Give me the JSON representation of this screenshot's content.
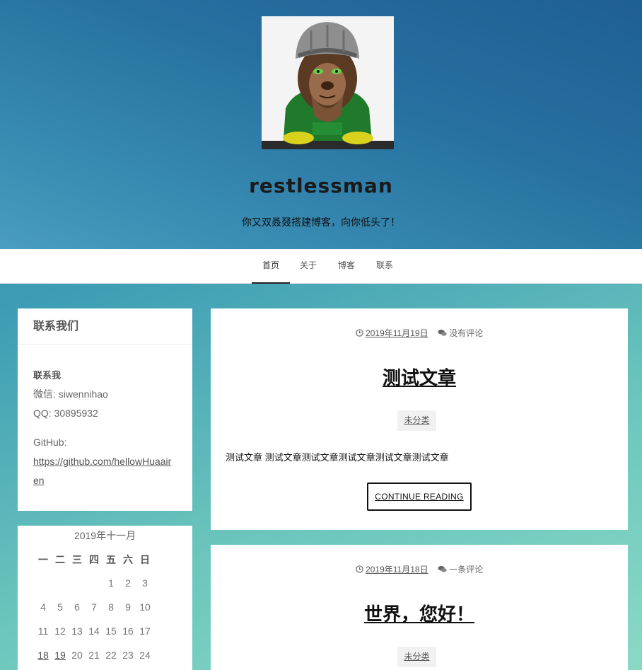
{
  "header": {
    "title": "restlessman",
    "description": "你又双叒叕搭建博客，向你低头了！"
  },
  "nav": {
    "items": [
      {
        "label": "首页",
        "active": true
      },
      {
        "label": "关于",
        "active": false
      },
      {
        "label": "博客",
        "active": false
      },
      {
        "label": "联系",
        "active": false
      }
    ]
  },
  "sidebar": {
    "contact": {
      "title": "联系我们",
      "heading": "联系我",
      "wechat": "微信: siwennihao",
      "qq": "QQ: 30895932",
      "github_label": "GitHub:",
      "github_url": "https://github.com/hellowHuaairen"
    },
    "calendar": {
      "caption": "2019年十一月",
      "weekdays": [
        "一",
        "二",
        "三",
        "四",
        "五",
        "六",
        "日"
      ],
      "weeks": [
        [
          "",
          "",
          "",
          "",
          "1",
          "2",
          "3"
        ],
        [
          "4",
          "5",
          "6",
          "7",
          "8",
          "9",
          "10"
        ],
        [
          "11",
          "12",
          "13",
          "14",
          "15",
          "16",
          "17"
        ],
        [
          "18",
          "19",
          "20",
          "21",
          "22",
          "23",
          "24"
        ]
      ],
      "linked_days": [
        "18",
        "19"
      ]
    }
  },
  "posts": [
    {
      "date": "2019年11月19日",
      "comments": "没有评论",
      "title": "测试文章",
      "category": "未分类",
      "excerpt": "测试文章 测试文章测试文章测试文章测试文章测试文章",
      "continue_label": "CONTINUE READING"
    },
    {
      "date": "2019年11月18日",
      "comments": "一条评论",
      "title": "世界，您好！",
      "category": "未分类"
    }
  ],
  "icons": {
    "clock": "clock-icon",
    "comments": "comments-icon"
  }
}
